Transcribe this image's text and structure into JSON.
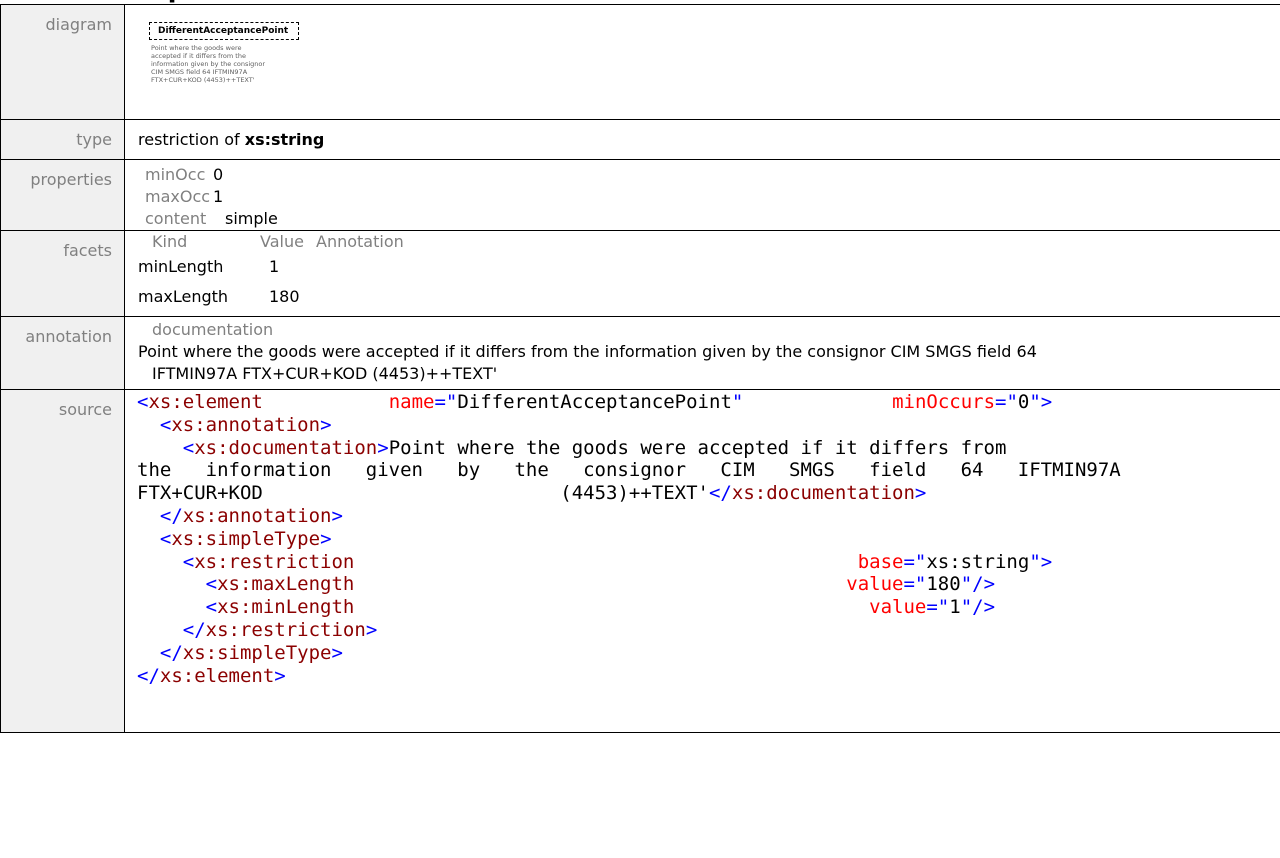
{
  "page_title_fragment": "ep",
  "labels": {
    "diagram": "diagram",
    "type": "type",
    "properties": "properties",
    "facets": "facets",
    "annotation": "annotation",
    "source": "source"
  },
  "diagram": {
    "element_name": "DifferentAcceptancePoint",
    "doc_lines": [
      "Point where the goods were",
      "accepted if it differs from the",
      "information given by the consignor",
      "CIM SMGS field 64 IFTMIN97A",
      "FTX+CUR+KOD (4453)++TEXT'"
    ]
  },
  "type": {
    "prefix": "restriction of",
    "base": "xs:string"
  },
  "properties": [
    {
      "key": "minOcc",
      "value": "0"
    },
    {
      "key": "maxOcc",
      "value": "1"
    },
    {
      "key": "content",
      "value": "simple"
    }
  ],
  "facets": {
    "headers": [
      "Kind",
      "Value",
      "Annotation"
    ],
    "rows": [
      {
        "kind": "minLength",
        "value": "1"
      },
      {
        "kind": "maxLength",
        "value": "180"
      }
    ]
  },
  "annotation": {
    "title": "documentation",
    "line1": "Point where the goods were accepted if it differs from the information given by the consignor CIM SMGS field 64",
    "line2": "IFTMIN97A  FTX+CUR+KOD (4453)++TEXT'"
  },
  "source": {
    "open_element": "xs:element",
    "name_attr": "name",
    "name_value": "DifferentAcceptancePoint",
    "minoccurs_attr": "minOccurs",
    "minoccurs_value": "0",
    "annotation_tag": "xs:annotation",
    "documentation_tag": "xs:documentation",
    "doc_line1": "Point where the goods were accepted if it differs from",
    "doc_line2": "the   information   given   by   the   consignor   CIM   SMGS   field   64   IFTMIN97A",
    "doc_line3_a": "FTX+CUR+KOD",
    "doc_line3_b": "(4453)++TEXT'",
    "simpletype_tag": "xs:simpleType",
    "restriction_tag": "xs:restriction",
    "base_attr": "base",
    "base_value": "xs:string",
    "maxlength_tag": "xs:maxLength",
    "maxlength_value": "180",
    "minlength_tag": "xs:minLength",
    "minlength_value": "1",
    "value_attr": "value"
  }
}
